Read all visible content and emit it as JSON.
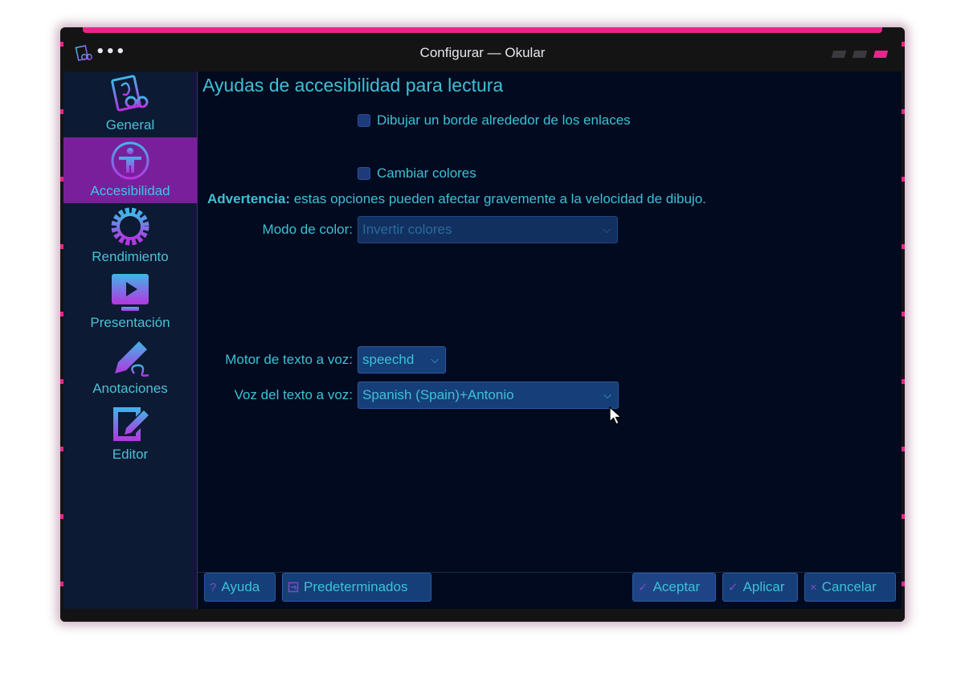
{
  "window": {
    "title": "Configurar — Okular",
    "menu_label": "•••",
    "accent_color": "#e8268a"
  },
  "sidebar": {
    "items": [
      {
        "label": "General",
        "icon": "general-icon",
        "active": false
      },
      {
        "label": "Accesibilidad",
        "icon": "accessibility-icon",
        "active": true
      },
      {
        "label": "Rendimiento",
        "icon": "performance-icon",
        "active": false
      },
      {
        "label": "Presentación",
        "icon": "presentation-icon",
        "active": false
      },
      {
        "label": "Anotaciones",
        "icon": "annotations-icon",
        "active": false
      },
      {
        "label": "Editor",
        "icon": "editor-icon",
        "active": false
      }
    ]
  },
  "main": {
    "title": "Ayudas de accesibilidad para lectura",
    "draw_border_label": "Dibujar un borde alrededor de los enlaces",
    "change_colors_label": "Cambiar colores",
    "warning_bold": "Advertencia:",
    "warning_text": " estas opciones pueden afectar gravemente a la velocidad de dibujo.",
    "color_mode_label": "Modo de color:",
    "color_mode_value": "Invertir colores",
    "tts_engine_label": "Motor de texto a voz:",
    "tts_engine_value": "speechd",
    "tts_voice_label": "Voz del texto a voz:",
    "tts_voice_value": "Spanish (Spain)+Antonio"
  },
  "buttons": {
    "help": "Ayuda",
    "help_glyph": "?",
    "defaults": "Predeterminados",
    "accept": "Aceptar",
    "accept_glyph": "✓",
    "apply": "Aplicar",
    "apply_glyph": "✓",
    "cancel": "Cancelar",
    "cancel_glyph": "×"
  },
  "chevron": "⌵"
}
